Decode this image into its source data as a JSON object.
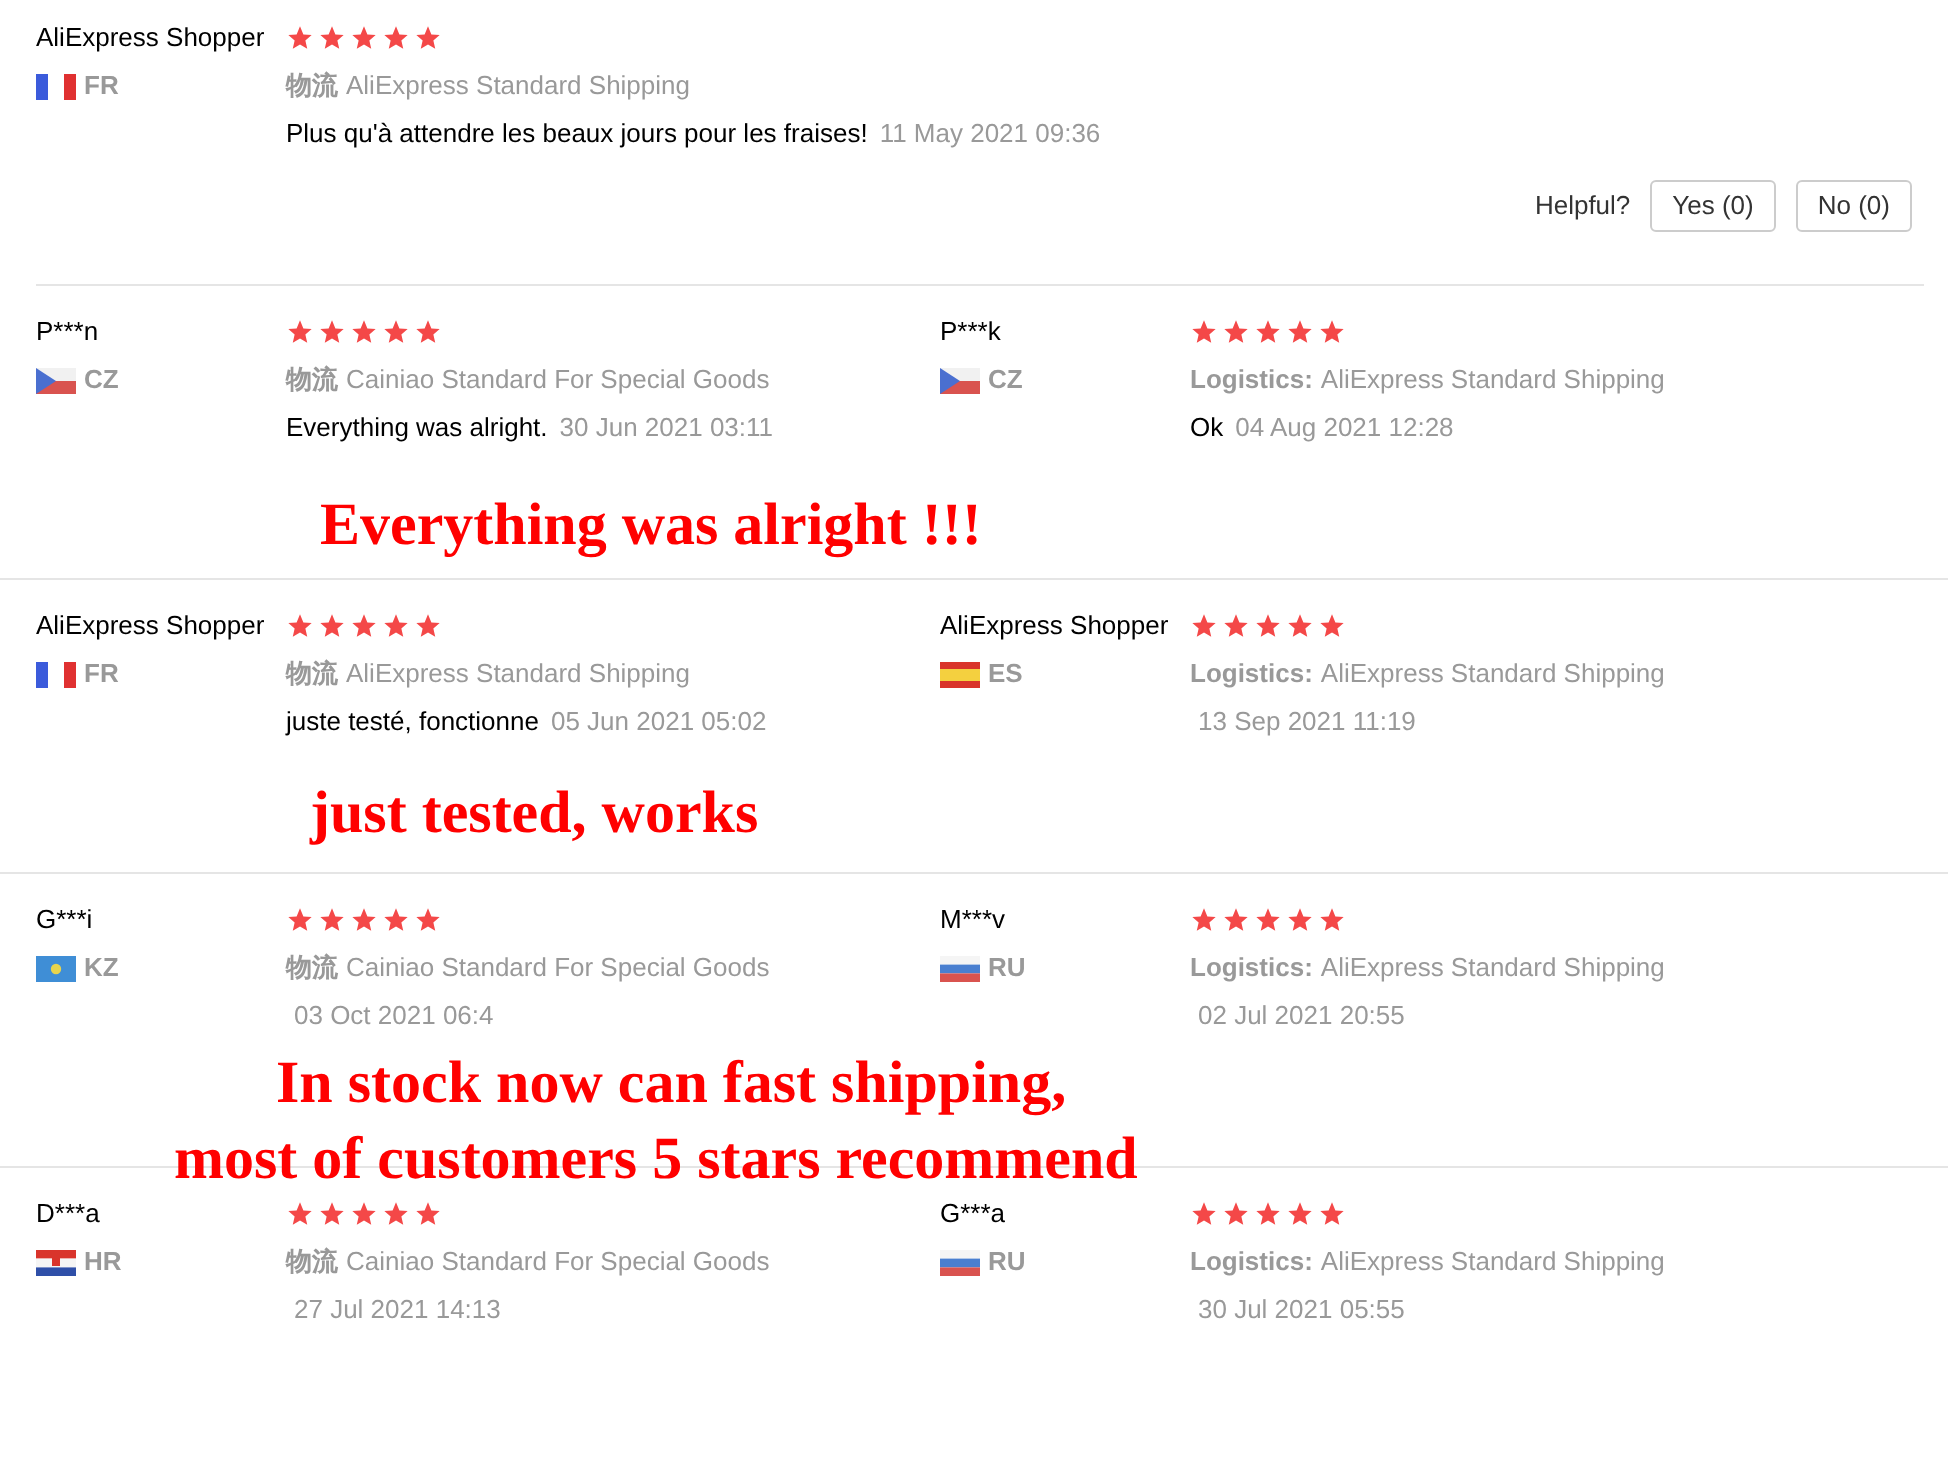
{
  "featured_review": {
    "name": "AliExpress Shopper",
    "stars": 5,
    "flag": {
      "kind": "fr"
    },
    "country": "FR",
    "logistics_label": "物流",
    "logistics": "AliExpress Standard Shipping",
    "comment": "Plus qu'à attendre les beaux jours pour les fraises!",
    "date": "11 May 2021 09:36"
  },
  "helpful": {
    "label": "Helpful?",
    "yes": "Yes (0)",
    "no": "No (0)"
  },
  "reviews": [
    {
      "name": "P***n",
      "stars": 5,
      "flag": {
        "kind": "cz"
      },
      "country": "CZ",
      "logistics_label": "物流",
      "logistics": "Cainiao Standard For Special Goods",
      "comment": "Everything was alright.",
      "date": "30 Jun 2021 03:11"
    },
    {
      "name": "P***k",
      "stars": 5,
      "flag": {
        "kind": "cz"
      },
      "country": "CZ",
      "logistics_label": "Logistics:",
      "logistics": "AliExpress Standard Shipping",
      "comment": "Ok",
      "date": "04 Aug 2021 12:28"
    },
    {
      "name": "AliExpress Shopper",
      "stars": 5,
      "flag": {
        "kind": "fr"
      },
      "country": "FR",
      "logistics_label": "物流",
      "logistics": "AliExpress Standard Shipping",
      "comment": "juste testé, fonctionne",
      "date": "05 Jun 2021 05:02"
    },
    {
      "name": "AliExpress Shopper",
      "stars": 5,
      "flag": {
        "kind": "es"
      },
      "country": "ES",
      "logistics_label": "Logistics:",
      "logistics": "AliExpress Standard Shipping",
      "date": "13 Sep 2021 11:19"
    },
    {
      "name": "G***i",
      "stars": 5,
      "flag": {
        "kind": "kz"
      },
      "country": "KZ",
      "logistics_label": "物流",
      "logistics": "Cainiao Standard For Special Goods",
      "date": "03 Oct 2021 06:4"
    },
    {
      "name": "M***v",
      "stars": 5,
      "flag": {
        "kind": "ru"
      },
      "country": "RU",
      "logistics_label": "Logistics:",
      "logistics": "AliExpress Standard Shipping",
      "date": "02 Jul 2021 20:55"
    },
    {
      "name": "D***a",
      "stars": 5,
      "flag": {
        "kind": "hr"
      },
      "country": "HR",
      "logistics_label": "物流",
      "logistics": "Cainiao Standard For Special Goods",
      "date": "27 Jul 2021 14:13"
    },
    {
      "name": "G***a",
      "stars": 5,
      "flag": {
        "kind": "ru"
      },
      "country": "RU",
      "logistics_label": "Logistics:",
      "logistics": "AliExpress Standard Shipping",
      "date": "30 Jul 2021 05:55"
    }
  ],
  "banners": [
    "Everything was alright !!!",
    "just tested, works",
    "In stock now can fast shipping,",
    "most of customers 5 stars recommend"
  ]
}
